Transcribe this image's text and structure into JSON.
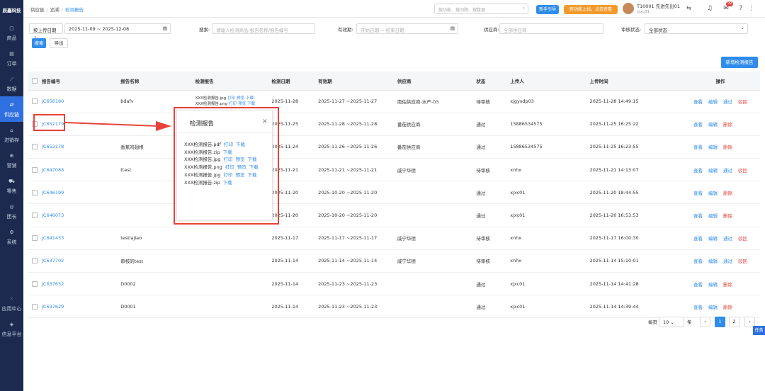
{
  "sidebar": {
    "logo": "辰鑫科技",
    "items": [
      {
        "label": "商品"
      },
      {
        "label": "订单"
      },
      {
        "label": "数据"
      },
      {
        "label": "供应链"
      },
      {
        "label": "进销存"
      },
      {
        "label": "营销"
      },
      {
        "label": "零售"
      },
      {
        "label": "团长"
      },
      {
        "label": "系统"
      },
      {
        "label": "应用中心"
      },
      {
        "label": "信息平台"
      }
    ]
  },
  "topbar": {
    "crumbs": [
      "供应链",
      "追溯",
      "检测报告"
    ],
    "search_placeholder": "搜功能、搜问题、搜数据",
    "new_guide": "新手引导",
    "promo": "新功能上线，点击查看",
    "user_name": "T10001 先进先出01",
    "user_sub": "xjxc01",
    "badge": "99"
  },
  "filters": {
    "date_type": "按上传日期",
    "date_range": "2025-11-09 ~ 2025-12-08",
    "search_label": "搜索:",
    "search_placeholder": "请输入检测商品/报告名称/报告编号",
    "valid_label": "有效期:",
    "valid_placeholder": "开始日期 ~ 结束日期",
    "supplier_label": "供应商:",
    "supplier_placeholder": "全部供应商",
    "status_label": "审核状态:",
    "status_value": "全部状态",
    "search_btn": "搜索",
    "export_btn": "导出",
    "add_btn": "新增检测报告"
  },
  "table": {
    "headers": [
      "报告编号",
      "报告名称",
      "检测报告",
      "检测日期",
      "有效期",
      "供应商",
      "状态",
      "上传人",
      "上传时间",
      "操作"
    ],
    "rows": [
      {
        "id": "JC656180",
        "name": "bdafv",
        "files": [
          "XXX检测报告.jpg",
          "XXX检测报告.png"
        ],
        "date": "2025-11-28",
        "valid": "2025-11-27 ~2025-11-27",
        "supplier": "南佑供应商-水产-03",
        "status": "待审核",
        "uploader": "xjgysdp03",
        "time": "2025-11-28 14:49:15",
        "ops": [
          "查看",
          "编辑",
          "通过",
          "驳回"
        ]
      },
      {
        "id": "JC652179",
        "name": "",
        "files": [],
        "date": "2025-11-25",
        "valid": "2025-11-28 ~2025-11-28",
        "supplier": "番茄供应商",
        "status": "通过",
        "uploader": "15886534575",
        "time": "2025-11-25 16:25:22",
        "ops": [
          "查看",
          "编辑",
          "删除"
        ]
      },
      {
        "id": "JC652178",
        "name": "香蕉鸡翅根",
        "files": [],
        "date": "2025-11-24",
        "valid": "2025-11-26 ~2025-11-26",
        "supplier": "番茄供应商",
        "status": "通过",
        "uploader": "15886534575",
        "time": "2025-11-25 16:23:55",
        "ops": [
          "查看",
          "编辑",
          "删除"
        ]
      },
      {
        "id": "JC647083",
        "name": "ttest",
        "files": [],
        "date": "2025-11-21",
        "valid": "2025-11-21 ~2025-11-21",
        "supplier": "威宁华德",
        "status": "待审核",
        "uploader": "xnhx",
        "time": "2025-11-21 14:13:07",
        "ops": [
          "查看",
          "编辑",
          "通过",
          "驳回"
        ]
      },
      {
        "id": "JC646199",
        "name": "",
        "files": [],
        "date": "2025-11-20",
        "valid": "2025-10-20 ~2025-11-20",
        "supplier": "",
        "status": "通过",
        "uploader": "xjxc01",
        "time": "2025-11-20 18:44:55",
        "ops": [
          "查看",
          "编辑",
          "删除"
        ]
      },
      {
        "id": "JC646073",
        "name": "",
        "files": [],
        "date": "2025-11-20",
        "valid": "2025-10-20 ~2025-11-20",
        "supplier": "",
        "status": "通过",
        "uploader": "xjxc01",
        "time": "2025-11-20 16:53:53",
        "ops": [
          "查看",
          "编辑",
          "删除"
        ]
      },
      {
        "id": "JC641433",
        "name": "testlajiao",
        "files": [],
        "date": "2025-11-17",
        "valid": "2025-11-17 ~2025-11-17",
        "supplier": "威宁华德",
        "status": "待审核",
        "uploader": "xnhx",
        "time": "2025-11-17 16:00:30",
        "ops": [
          "查看",
          "编辑",
          "通过",
          "驳回"
        ]
      },
      {
        "id": "JC637702",
        "name": "审核的test",
        "files": [],
        "date": "2025-11-14",
        "valid": "2025-11-14 ~2025-11-14",
        "supplier": "威宁华德",
        "status": "待审核",
        "uploader": "xnhx",
        "time": "2025-11-14 15:10:01",
        "ops": [
          "查看",
          "编辑",
          "通过",
          "驳回"
        ]
      },
      {
        "id": "JC637632",
        "name": "D0002",
        "files": [],
        "date": "2025-11-14",
        "valid": "2025-11-23 ~2025-11-23",
        "supplier": "",
        "status": "通过",
        "uploader": "xjxc01",
        "time": "2025-11-14 14:41:28",
        "ops": [
          "查看",
          "编辑",
          "删除"
        ]
      },
      {
        "id": "JC637629",
        "name": "D0001",
        "files": [],
        "date": "2025-11-14",
        "valid": "2025-11-23 ~2025-11-23",
        "supplier": "",
        "status": "通过",
        "uploader": "xjxc01",
        "time": "2025-11-14 14:39:44",
        "ops": [
          "查看",
          "编辑",
          "删除"
        ]
      }
    ]
  },
  "file_actions": {
    "print": "打印",
    "preview": "预览",
    "download": "下载"
  },
  "pagination": {
    "per_page_label": "每页",
    "per_page": "10",
    "unit": "条",
    "pages": [
      "1",
      "2"
    ]
  },
  "task_label": "任务",
  "popup": {
    "title": "检测报告",
    "files": [
      {
        "name": "XXX检测报告.pdf",
        "actions": [
          "打印",
          "下载"
        ]
      },
      {
        "name": "XXX检测报告.zip",
        "actions": [
          "下载"
        ]
      },
      {
        "name": "XXX检测报告.jpg",
        "actions": [
          "打印",
          "预览",
          "下载"
        ]
      },
      {
        "name": "XXX检测报告.png",
        "actions": [
          "打印",
          "预览",
          "下载"
        ]
      },
      {
        "name": "XXX检测报告.jpg",
        "actions": [
          "打印",
          "预览",
          "下载"
        ]
      },
      {
        "name": "XXX检测报告.zip",
        "actions": [
          "下载"
        ]
      }
    ]
  }
}
